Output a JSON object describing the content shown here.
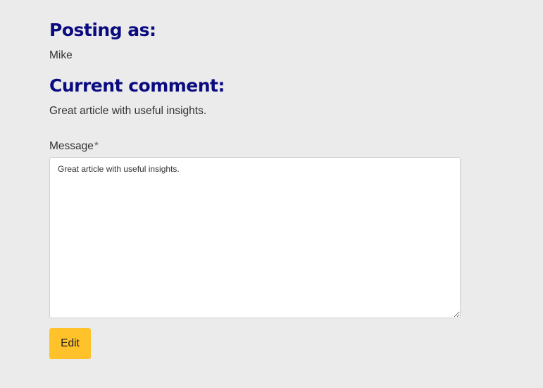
{
  "posting_as": {
    "heading": "Posting as:",
    "username": "Mike"
  },
  "current_comment": {
    "heading": "Current comment:",
    "text": "Great article with useful insights."
  },
  "form": {
    "message_label": "Message",
    "required_marker": "*",
    "message_value": "Great article with useful insights.",
    "submit_label": "Edit"
  },
  "colors": {
    "background": "#ebebeb",
    "heading": "#0b0b80",
    "button": "#ffc22b"
  }
}
